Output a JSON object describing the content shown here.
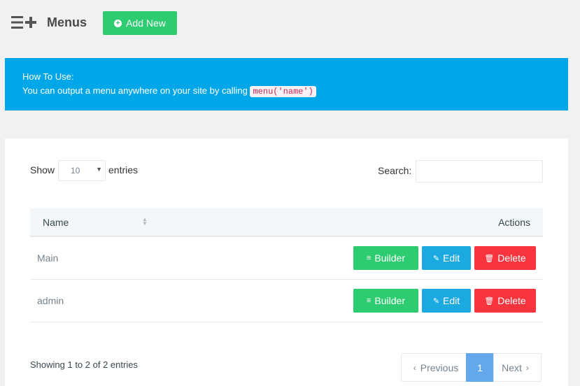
{
  "header": {
    "icon": "menu-plus-icon",
    "title": "Menus",
    "add_new_label": "Add New"
  },
  "info": {
    "title": "How To Use:",
    "text": "You can output a menu anywhere on your site by calling",
    "code": "menu('name')"
  },
  "table_controls": {
    "show_label": "Show",
    "length_value": "10",
    "entries_label": "entries",
    "search_label": "Search:",
    "search_value": ""
  },
  "table": {
    "columns": [
      "Name",
      "Actions"
    ],
    "rows": [
      {
        "name": "Main"
      },
      {
        "name": "admin"
      }
    ],
    "actions": {
      "builder": "Builder",
      "edit": "Edit",
      "delete": "Delete"
    }
  },
  "footer": {
    "info": "Showing 1 to 2 of 2 entries",
    "previous": "Previous",
    "current_page": "1",
    "next": "Next"
  },
  "colors": {
    "success": "#2ecc71",
    "info": "#00a7e8",
    "edit": "#1ba9e1",
    "danger": "#f8343f",
    "pager_active": "#62a8ea"
  }
}
